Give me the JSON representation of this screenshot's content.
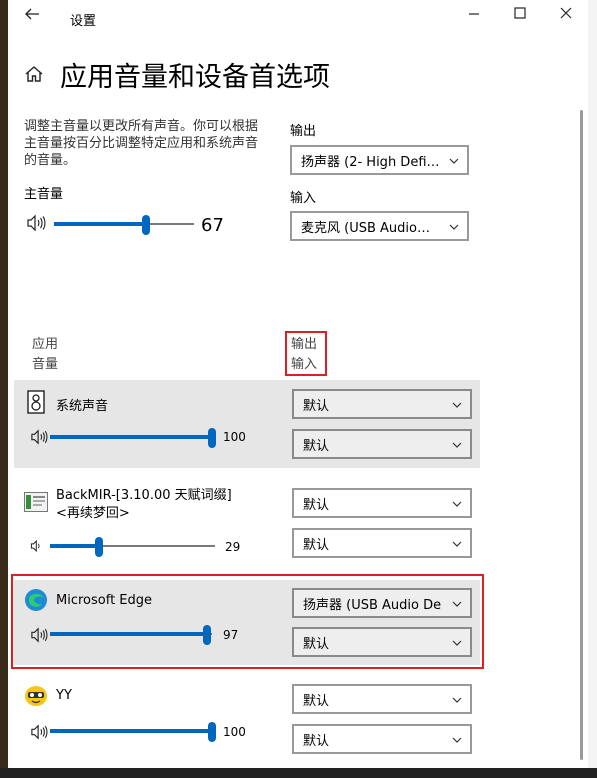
{
  "window": {
    "title": "设置"
  },
  "page": {
    "title": "应用音量和设备首选项"
  },
  "description": "调整主音量以更改所有声音。你可以根据主音量按百分比调整特定应用和系统声音的音量。",
  "master": {
    "label": "主音量",
    "value": 67
  },
  "output_device": {
    "label": "输出",
    "selected": "扬声器 (2- High Defi…"
  },
  "input_device": {
    "label": "输入",
    "selected": "麦克风 (USB Audio…"
  },
  "headers": {
    "app_line1": "应用",
    "app_line2": "音量",
    "io_line1": "输出",
    "io_line2": "输入"
  },
  "apps": [
    {
      "name": "系统声音",
      "volume": 100,
      "output": "默认",
      "input": "默认",
      "icon": "system-sounds-icon"
    },
    {
      "name_line1": "BackMIR-[3.10.00 天赋词缀]",
      "name_line2": "<再续梦回>",
      "volume": 29,
      "output": "默认",
      "input": "默认",
      "icon": "backmir-app-icon"
    },
    {
      "name": "Microsoft Edge",
      "volume": 97,
      "output": "扬声器 (USB Audio De",
      "input": "默认",
      "icon": "edge-icon"
    },
    {
      "name": "YY",
      "volume": 100,
      "output": "默认",
      "input": "默认",
      "icon": "yy-app-icon"
    }
  ],
  "colors": {
    "accent": "#0067c0",
    "highlight": "#e02020",
    "selected_row": "#e6e6e6"
  }
}
